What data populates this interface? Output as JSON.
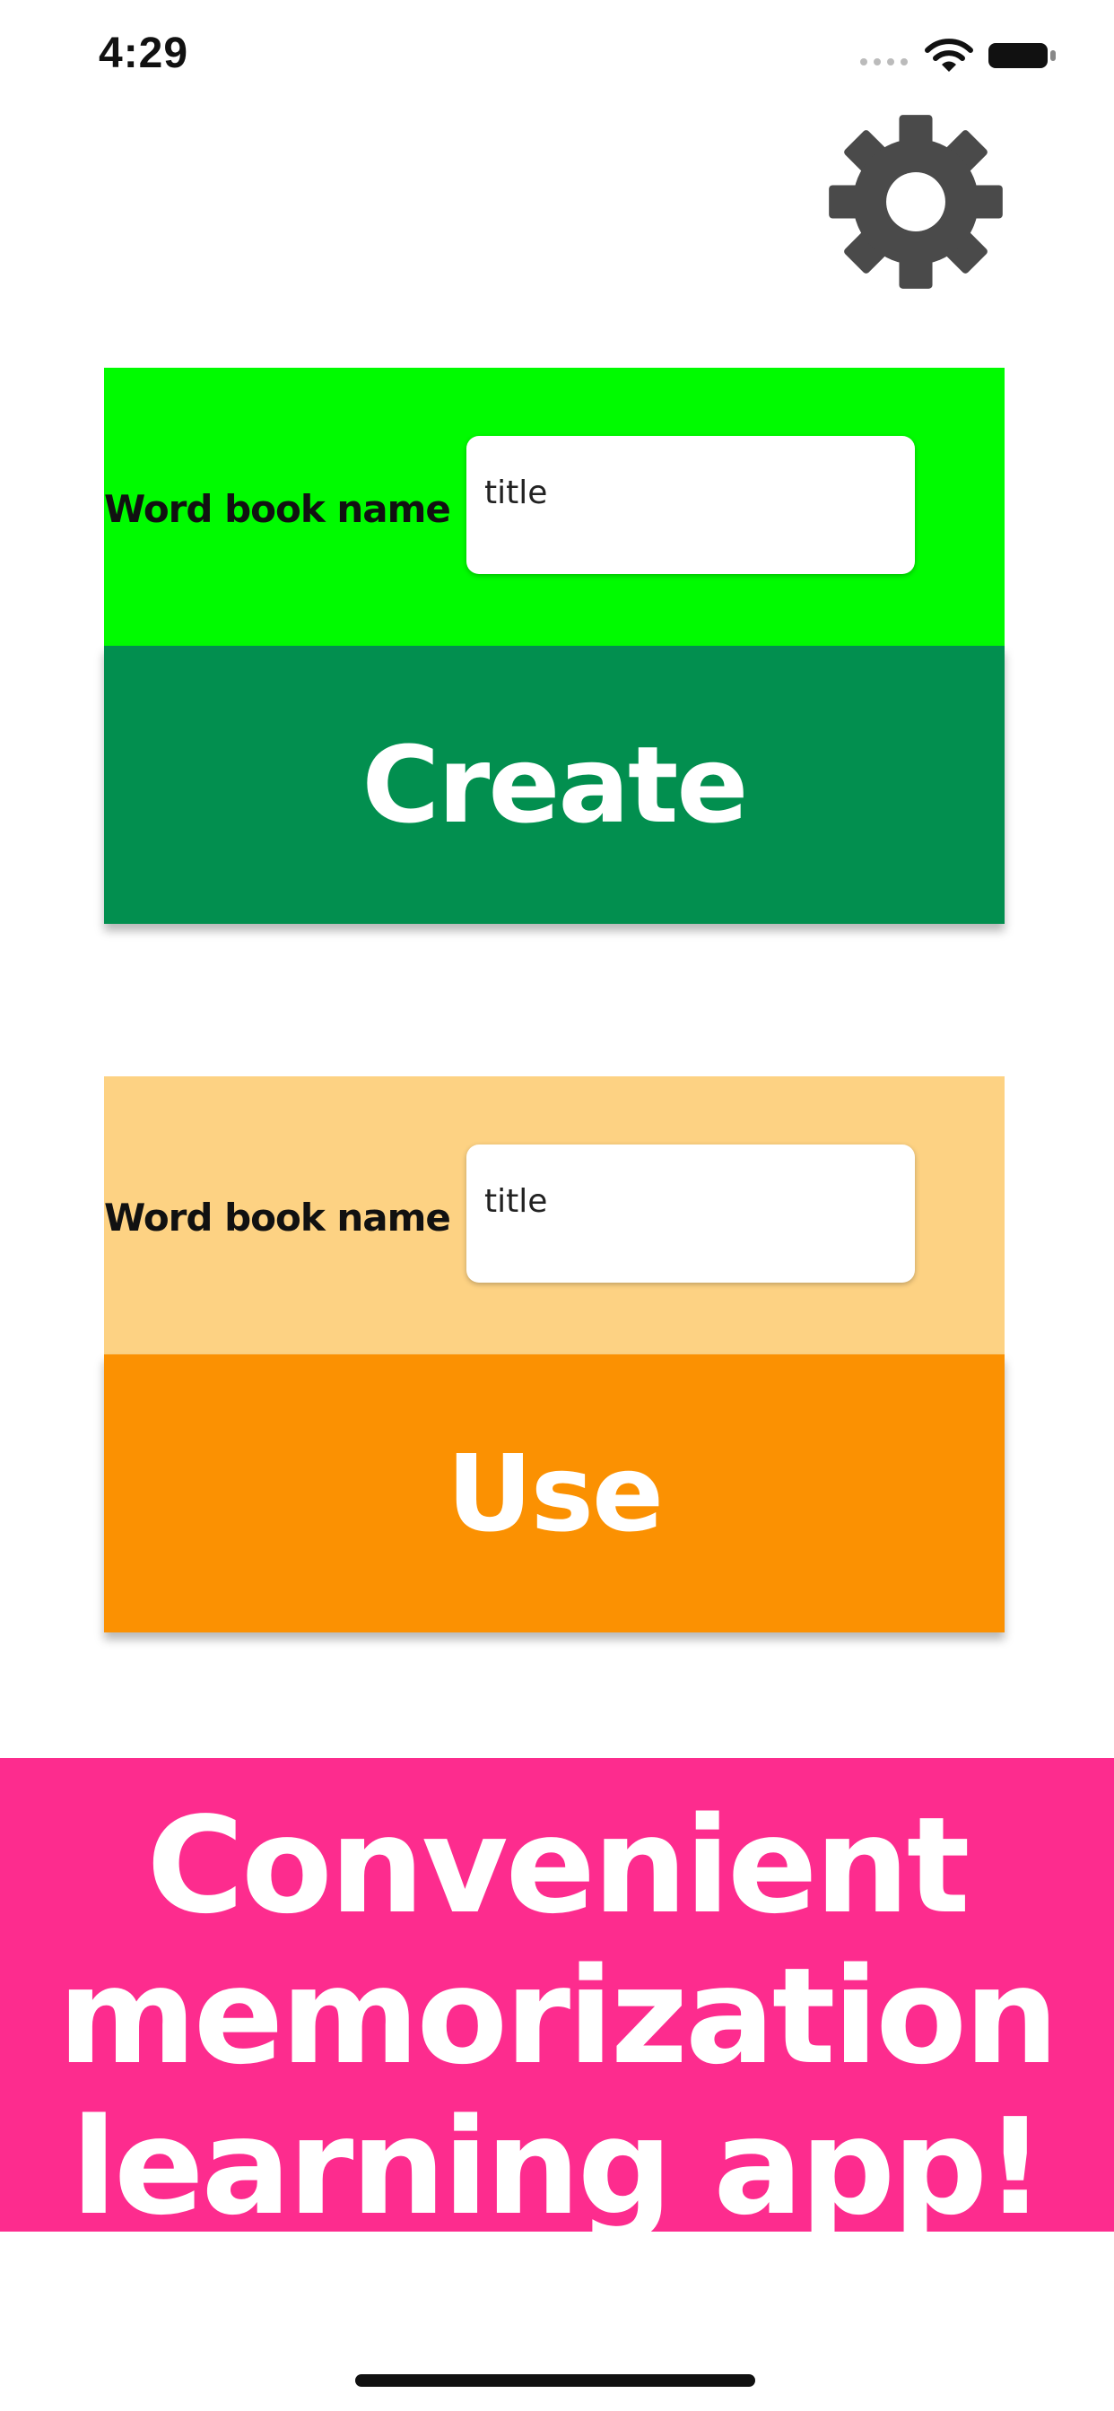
{
  "status_bar": {
    "time": "4:29",
    "icons": [
      "signal-dots-icon",
      "wifi-icon",
      "battery-icon"
    ]
  },
  "header": {
    "settings_icon": "gear-icon"
  },
  "create_section": {
    "label": "Word book name",
    "input_placeholder": "title",
    "input_value": "",
    "button_label": "Create",
    "colors": {
      "panel": "#00fb00",
      "button": "#028f4f"
    }
  },
  "use_section": {
    "label": "Word book name",
    "input_placeholder": "title",
    "input_value": "",
    "button_label": "Use",
    "colors": {
      "panel": "#fdd283",
      "button": "#fb9102"
    }
  },
  "banner": {
    "lines": [
      "Convenient",
      "memorization",
      "learning app!"
    ],
    "color": "#fd2c8e"
  }
}
